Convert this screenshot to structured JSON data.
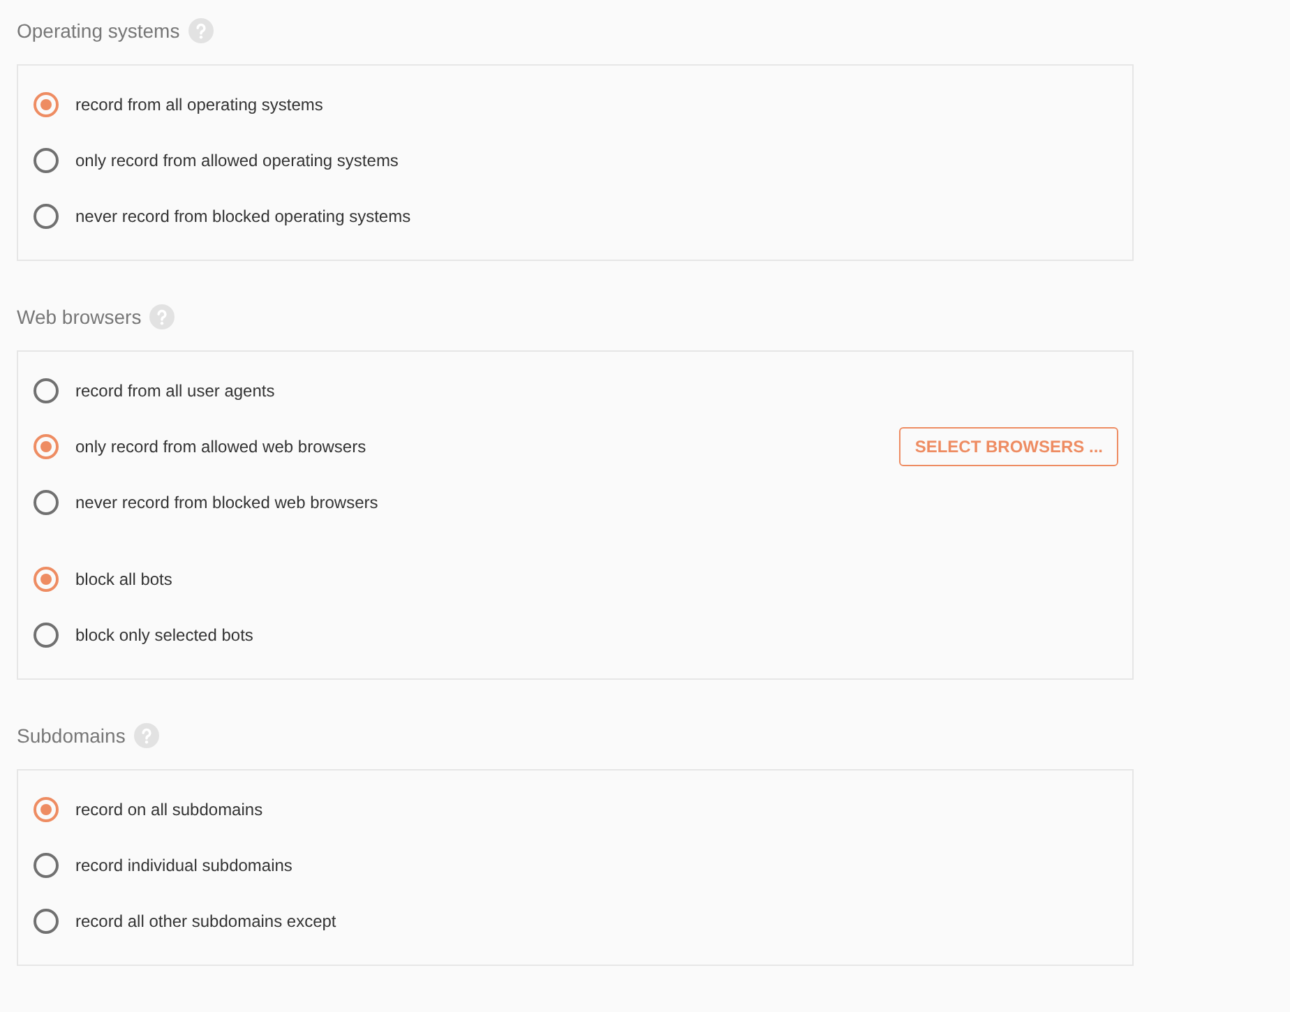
{
  "sections": [
    {
      "title": "Operating systems",
      "groups": [
        {
          "options": [
            {
              "label": "record from all operating systems",
              "selected": true
            },
            {
              "label": "only record from allowed operating systems",
              "selected": false
            },
            {
              "label": "never record from blocked operating systems",
              "selected": false
            }
          ]
        }
      ]
    },
    {
      "title": "Web browsers",
      "groups": [
        {
          "options": [
            {
              "label": "record from all user agents",
              "selected": false
            },
            {
              "label": "only record from allowed web browsers",
              "selected": true,
              "action": "SELECT BROWSERS ..."
            },
            {
              "label": "never record from blocked web browsers",
              "selected": false
            }
          ]
        },
        {
          "options": [
            {
              "label": "block all bots",
              "selected": true
            },
            {
              "label": "block only selected bots",
              "selected": false
            }
          ]
        }
      ]
    },
    {
      "title": "Subdomains",
      "groups": [
        {
          "options": [
            {
              "label": "record on all subdomains",
              "selected": true
            },
            {
              "label": "record individual subdomains",
              "selected": false
            },
            {
              "label": "record all other subdomains except",
              "selected": false
            }
          ]
        }
      ]
    }
  ]
}
